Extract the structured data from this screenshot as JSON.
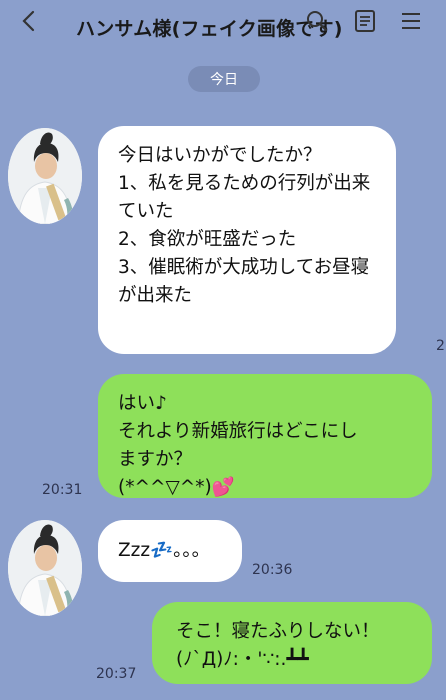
{
  "header": {
    "title": "ハンサム様(フェイク画像です)",
    "back_icon": "chevron-left-icon",
    "search_icon": "search-icon",
    "notes_icon": "notes-icon",
    "menu_icon": "hamburger-menu-icon"
  },
  "date_badge": "今日",
  "messages": [
    {
      "side": "left",
      "lines": [
        "今日はいかがでしたか？",
        "",
        "1、私を見るための行列が出来",
        "ていた",
        "",
        "2、食欲が旺盛だった",
        "",
        "3、催眠術が大成功してお昼寝",
        "が出来た"
      ],
      "time": "2"
    },
    {
      "side": "right",
      "lines": [
        "はい♪",
        "それより新婚旅行はどこにし",
        "ますか？",
        "(*^^▽^*)💕"
      ],
      "time": "20:31"
    },
    {
      "side": "left",
      "lines": [
        "Zzz💤。。。"
      ],
      "time": "20:36"
    },
    {
      "side": "right",
      "lines": [
        "そこ！寝たふりしない！",
        "(ﾉ`Д)ﾉ:・'∵:.┻┻"
      ],
      "time": "20:37"
    }
  ],
  "colors": {
    "background": "#8b9fcc",
    "sent_bubble": "#8ee05a",
    "received_bubble": "#ffffff",
    "date_badge": "#7a8cb6"
  }
}
